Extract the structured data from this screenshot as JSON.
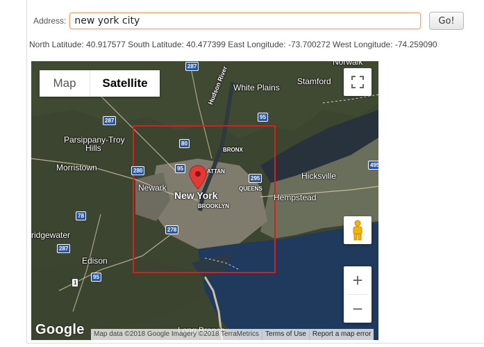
{
  "form": {
    "address_label": "Address:",
    "address_value": "new york city",
    "go_label": "Go!"
  },
  "coords_text": "North Latitude: 40.917577 South Latitude: 40.477399 East Longitude: -73.700272 West Longitude: -74.259090",
  "map": {
    "type_map_label": "Map",
    "type_satellite_label": "Satellite",
    "zoom_in_label": "+",
    "zoom_out_label": "−",
    "google_logo": "Google",
    "attribution": "Map data ©2018 Google Imagery ©2018 TerraMetrics",
    "terms_label": "Terms of Use",
    "report_label": "Report a map error",
    "bounds_color": "#e11b1b",
    "marker_color": "#e53935",
    "places": {
      "white_plains": "White Plains",
      "stamford": "Stamford",
      "parsippany": "Parsippany-Troy",
      "hills": "Hills",
      "morristown": "Morristown",
      "newark": "Newark",
      "new_york": "New York",
      "hicksville": "Hicksville",
      "hempstead": "Hempstead",
      "bridgewater": "ridgewater",
      "edison": "Edison",
      "bronx": "BRONX",
      "manhattan": "ATTAN",
      "queens": "QUEENS",
      "brooklyn": "BROOKLYN",
      "hudson": "Hudson River",
      "long_branch": "Long Branch",
      "norwalk": "Norwalk"
    },
    "shields": {
      "s287a": "287",
      "s287b": "287",
      "s287c": "287",
      "s95a": "95",
      "s95b": "95",
      "s80": "80",
      "s280": "280",
      "s95c": "95",
      "s295": "295",
      "s78": "78",
      "s278": "278",
      "s1": "1",
      "s495": "495"
    }
  }
}
